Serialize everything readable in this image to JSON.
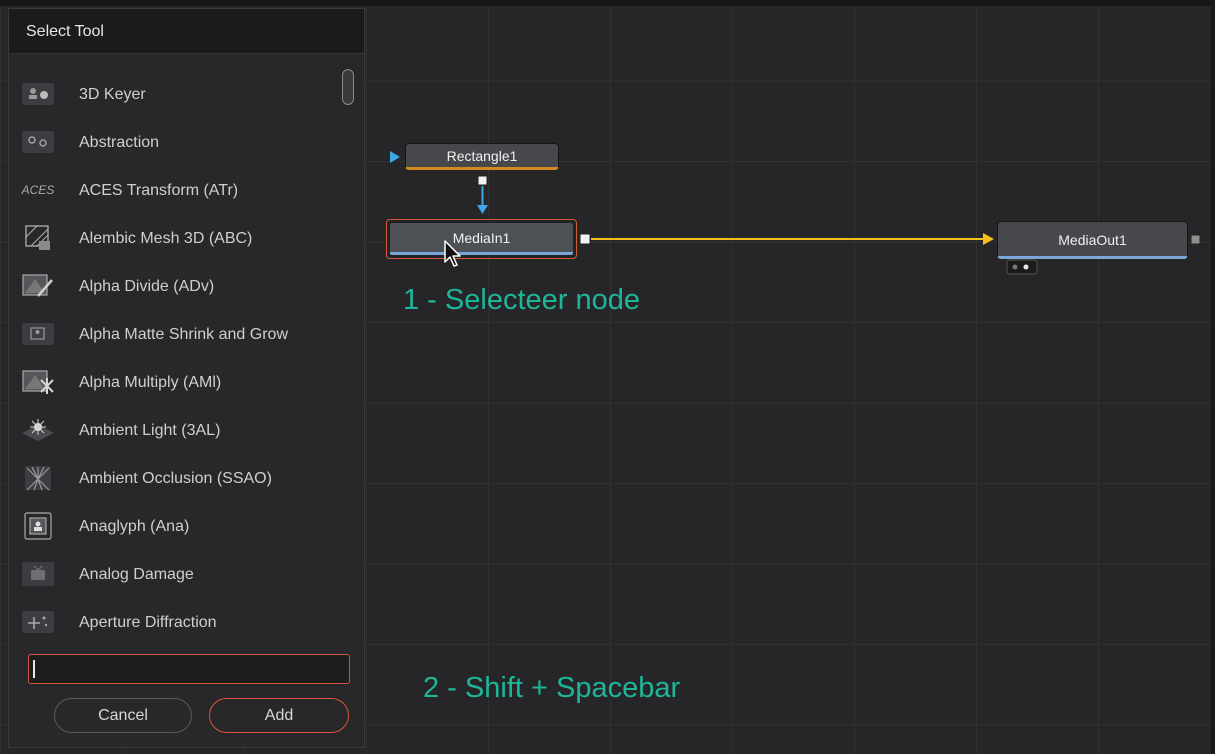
{
  "dialog": {
    "title": "Select Tool",
    "tools": [
      {
        "label": "3D Keyer",
        "icon": "3d-keyer-icon"
      },
      {
        "label": "Abstraction",
        "icon": "abstraction-icon"
      },
      {
        "label": "ACES Transform (ATr)",
        "icon": "aces-icon",
        "icon_text": "ACES"
      },
      {
        "label": "Alembic Mesh 3D (ABC)",
        "icon": "alembic-mesh-icon"
      },
      {
        "label": "Alpha Divide (ADv)",
        "icon": "alpha-divide-icon"
      },
      {
        "label": "Alpha Matte Shrink and Grow",
        "icon": "alpha-matte-icon"
      },
      {
        "label": "Alpha Multiply (AMl)",
        "icon": "alpha-multiply-icon"
      },
      {
        "label": "Ambient Light (3AL)",
        "icon": "ambient-light-icon"
      },
      {
        "label": "Ambient Occlusion (SSAO)",
        "icon": "ambient-occlusion-icon"
      },
      {
        "label": "Anaglyph (Ana)",
        "icon": "anaglyph-icon"
      },
      {
        "label": "Analog Damage",
        "icon": "analog-damage-icon"
      },
      {
        "label": "Aperture Diffraction",
        "icon": "aperture-diffraction-icon"
      }
    ],
    "search": {
      "value": "",
      "placeholder": ""
    },
    "cancel_label": "Cancel",
    "add_label": "Add"
  },
  "nodes": {
    "rectangle": "Rectangle1",
    "media_in": "MediaIn1",
    "media_out": "MediaOut1"
  },
  "annotations": {
    "step1": "1 - Selecteer node",
    "step2": "2 - Shift + Spacebar"
  },
  "colors": {
    "accent_red": "#d9573c",
    "link_yellow": "#f2c21b",
    "link_blue": "#3ea7e8",
    "annotation_green": "#1fb59a",
    "node_orange": "#d08a1f",
    "node_blue": "#7aa6d9"
  }
}
